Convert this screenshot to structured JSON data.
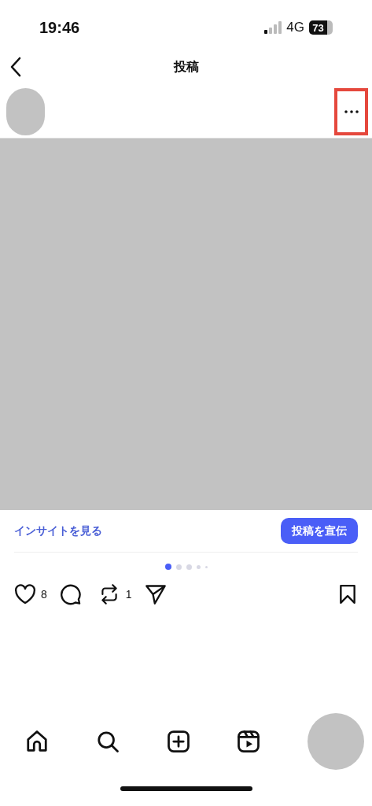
{
  "status_bar": {
    "time": "19:46",
    "network": "4G",
    "battery": "73"
  },
  "header": {
    "title": "投稿"
  },
  "post": {
    "more_highlighted": true
  },
  "insights": {
    "link": "インサイトを見る",
    "promote": "投稿を宣伝"
  },
  "page_dots": [
    {
      "selected": true
    },
    {
      "selected": false
    },
    {
      "selected": false
    },
    {
      "selected": false
    },
    {
      "selected": false
    }
  ],
  "actions": {
    "likes": "8",
    "reposts": "1"
  },
  "nav": [
    {
      "kind": "home"
    },
    {
      "kind": "search"
    },
    {
      "kind": "create"
    },
    {
      "kind": "reels"
    },
    {
      "kind": "profile"
    }
  ]
}
